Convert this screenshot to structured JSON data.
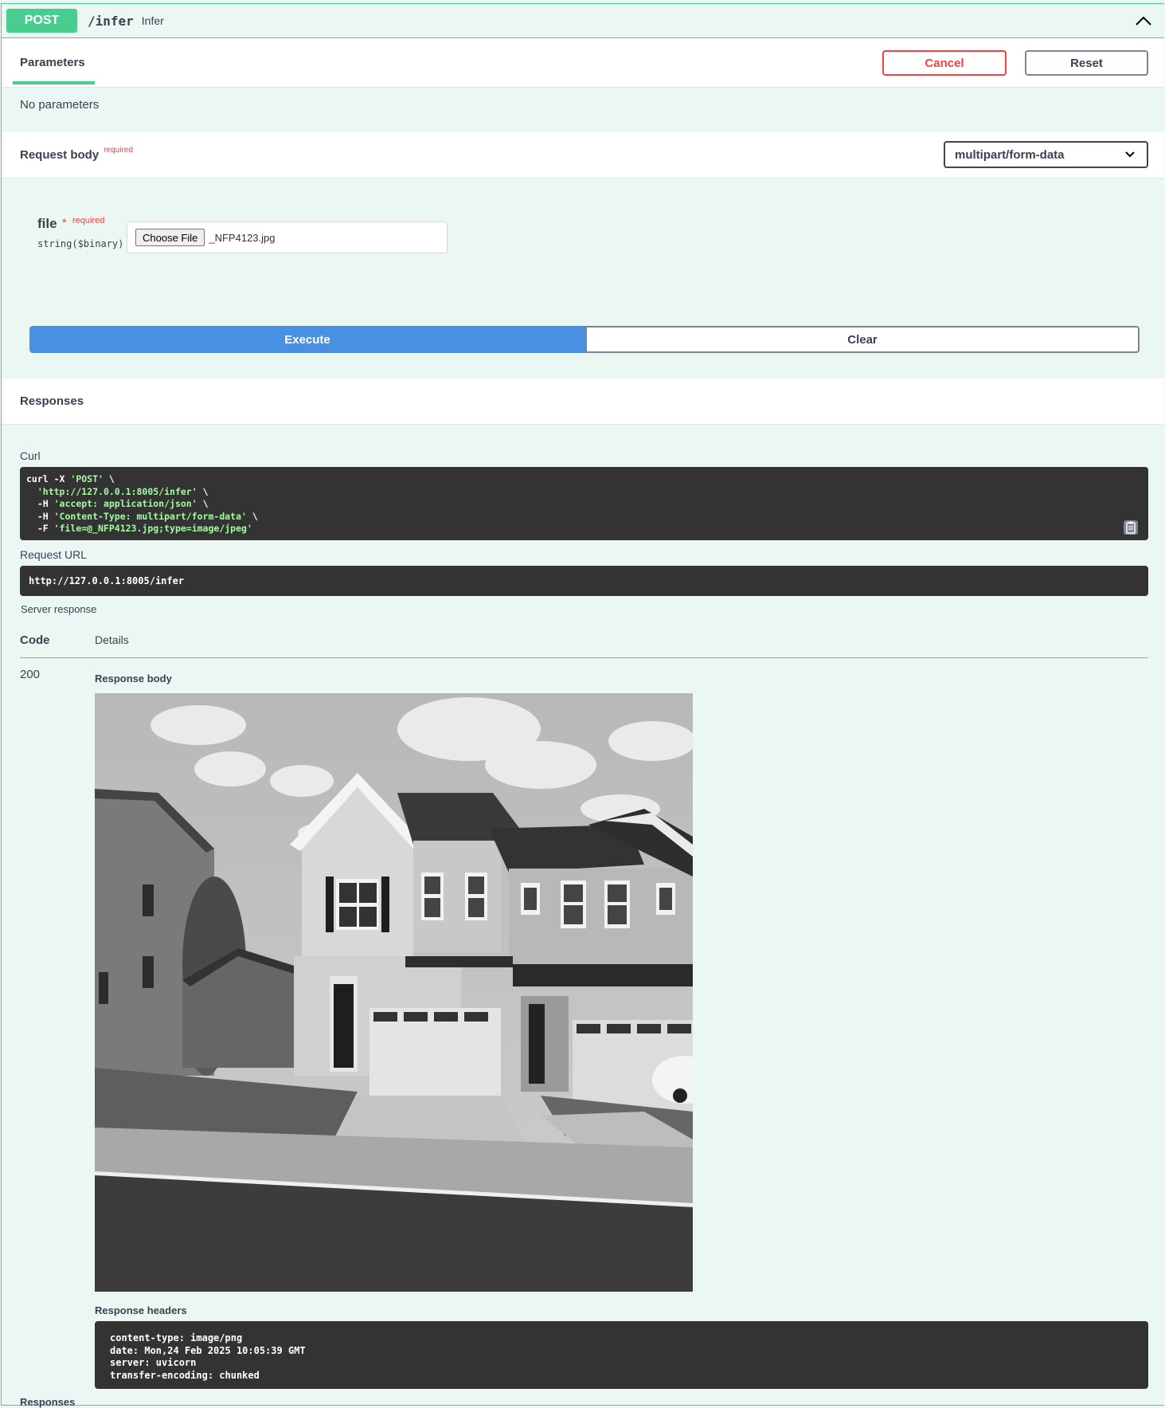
{
  "operation": {
    "method": "POST",
    "path": "/infer",
    "description": "Infer"
  },
  "tabs": {
    "parameters_label": "Parameters",
    "cancel_label": "Cancel",
    "reset_label": "Reset"
  },
  "parameters": {
    "empty_text": "No parameters"
  },
  "request_body": {
    "label": "Request body",
    "required_text": "required",
    "content_type": "multipart/form-data",
    "file_field": {
      "name": "file",
      "star": "*",
      "required_text": "required",
      "type": "string($binary)",
      "choose_button": "Choose File",
      "file_name": "_NFP4123.jpg"
    }
  },
  "actions": {
    "execute_label": "Execute",
    "clear_label": "Clear"
  },
  "responses": {
    "heading": "Responses",
    "curl_label": "Curl",
    "curl_lines": [
      [
        "curl -X ",
        "'POST'",
        " \\"
      ],
      [
        "  ",
        "'http://127.0.0.1:8005/infer'",
        " \\"
      ],
      [
        "  -H ",
        "'accept: application/json'",
        " \\"
      ],
      [
        "  -H ",
        "'Content-Type: multipart/form-data'",
        " \\"
      ],
      [
        "  -F ",
        "'file=@_NFP4123.jpg;type=image/jpeg'",
        ""
      ]
    ],
    "request_url_label": "Request URL",
    "request_url": "http://127.0.0.1:8005/infer",
    "server_response_label": "Server response",
    "code_header": "Code",
    "details_header": "Details",
    "status_code": "200",
    "response_body_label": "Response body",
    "response_headers_label": "Response headers",
    "response_headers": [
      "content-type: image/png",
      "date: Mon,24 Feb 2025 10:05:39 GMT",
      "server: uvicorn",
      "transfer-encoding: chunked"
    ],
    "bottom_label": "Responses"
  },
  "colors": {
    "post_green": "#49cc90",
    "execute_blue": "#4990e2",
    "cancel_red": "#f93e3e",
    "panel_bg": "#ebf7f2",
    "code_bg": "#333333"
  },
  "icons": {
    "collapse": "chevron-up-icon",
    "select": "chevron-down-icon",
    "copy": "clipboard-copy-icon"
  }
}
